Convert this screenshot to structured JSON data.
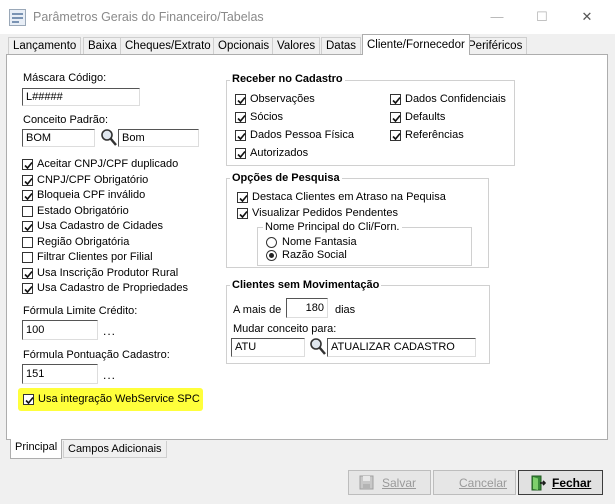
{
  "window": {
    "title": "Parâmetros Gerais do Financeiro/Tabelas",
    "min": "—",
    "max": "☐",
    "close": "✕"
  },
  "tabs": [
    {
      "label": "Lançamento"
    },
    {
      "label": "Baixa"
    },
    {
      "label": "Cheques/Extrato"
    },
    {
      "label": "Opcionais"
    },
    {
      "label": "Valores"
    },
    {
      "label": "Datas"
    },
    {
      "label": "Cliente/Fornecedor"
    },
    {
      "label": "Periféricos"
    }
  ],
  "left": {
    "mascara_label": "Máscara Código:",
    "mascara_value": "L#####",
    "conceito_label": "Conceito Padrão:",
    "conceito_code": "BOM",
    "conceito_desc": "Bom",
    "checks": [
      {
        "label": "Aceitar CNPJ/CPF duplicado",
        "checked": true
      },
      {
        "label": "CNPJ/CPF Obrigatório",
        "checked": true
      },
      {
        "label": "Bloqueia CPF inválido",
        "checked": true
      },
      {
        "label": "Estado Obrigatório",
        "checked": false
      },
      {
        "label": "Usa Cadastro de Cidades",
        "checked": true
      },
      {
        "label": "Região Obrigatória",
        "checked": false
      },
      {
        "label": "Filtrar Clientes por Filial",
        "checked": false
      },
      {
        "label": "Usa Inscrição Produtor Rural",
        "checked": true
      },
      {
        "label": "Usa Cadastro de Propriedades",
        "checked": true
      }
    ],
    "formula_limite_label": "Fórmula Limite Crédito:",
    "formula_limite_value": "100",
    "formula_pont_label": "Fórmula Pontuação Cadastro:",
    "formula_pont_value": "151",
    "ellipsis": "...",
    "ws_label": "Usa integração WebService SPC",
    "ws_checked": true
  },
  "receber": {
    "title": "Receber no Cadastro",
    "col1": [
      {
        "label": "Observações",
        "checked": true
      },
      {
        "label": "Sócios",
        "checked": true
      },
      {
        "label": "Dados Pessoa Física",
        "checked": true
      },
      {
        "label": "Autorizados",
        "checked": true
      }
    ],
    "col2": [
      {
        "label": "Dados Confidenciais",
        "checked": true
      },
      {
        "label": "Defaults",
        "checked": true
      },
      {
        "label": "Referências",
        "checked": true
      }
    ]
  },
  "pesquisa": {
    "title": "Opções de Pesquisa",
    "checks": [
      {
        "label": "Destaca Clientes em Atraso na Pequisa",
        "checked": true
      },
      {
        "label": "Visualizar Pedidos Pendentes",
        "checked": true
      }
    ],
    "nome_title": "Nome Principal do Cli/Forn.",
    "radios": [
      {
        "label": "Nome Fantasia",
        "selected": false
      },
      {
        "label": "Razão Social",
        "selected": true
      }
    ]
  },
  "movimentacao": {
    "title": "Clientes sem Movimentação",
    "mais_label": "A mais de",
    "dias_value": "180",
    "dias_label": "dias",
    "mudar_label": "Mudar conceito para:",
    "conceito_code": "ATU",
    "conceito_desc": "ATUALIZAR CADASTRO"
  },
  "bottom_tabs": [
    {
      "label": "Principal"
    },
    {
      "label": "Campos Adicionais"
    }
  ],
  "buttons": {
    "salvar": "Salvar",
    "cancelar": "Cancelar",
    "fechar": "Fechar"
  }
}
